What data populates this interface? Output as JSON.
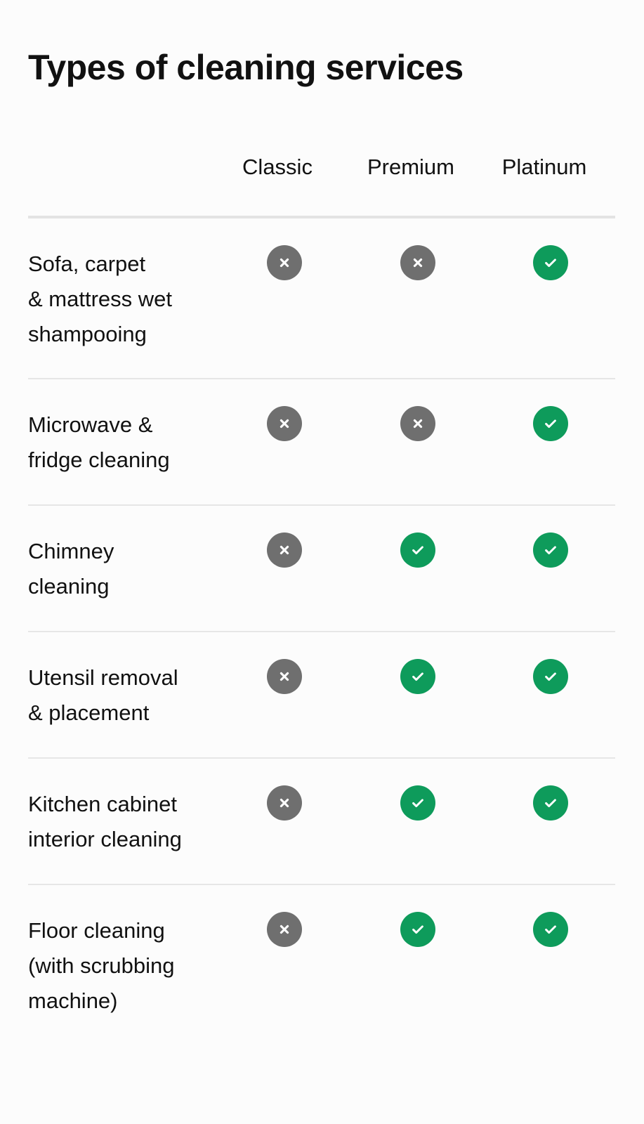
{
  "page": {
    "title": "Types of cleaning services"
  },
  "table": {
    "columns": [
      "Classic",
      "Premium",
      "Platinum"
    ],
    "rows": [
      {
        "label": "Sofa, carpet\n& mattress wet\nshampooing",
        "values": [
          false,
          false,
          true
        ]
      },
      {
        "label": "Microwave &\nfridge cleaning",
        "values": [
          false,
          false,
          true
        ]
      },
      {
        "label": "Chimney\ncleaning",
        "values": [
          false,
          true,
          true
        ]
      },
      {
        "label": "Utensil removal\n& placement",
        "values": [
          false,
          true,
          true
        ]
      },
      {
        "label": "Kitchen cabinet\ninterior cleaning",
        "values": [
          false,
          true,
          true
        ]
      },
      {
        "label": "Floor cleaning\n(with scrubbing\nmachine)",
        "values": [
          false,
          true,
          true
        ]
      }
    ]
  },
  "icons": {
    "included": "check-icon",
    "excluded": "cross-icon"
  },
  "colors": {
    "included": "#0e9b5b",
    "excluded": "#6f6f6f",
    "divider": "#e3e3e3",
    "text": "#111111"
  }
}
